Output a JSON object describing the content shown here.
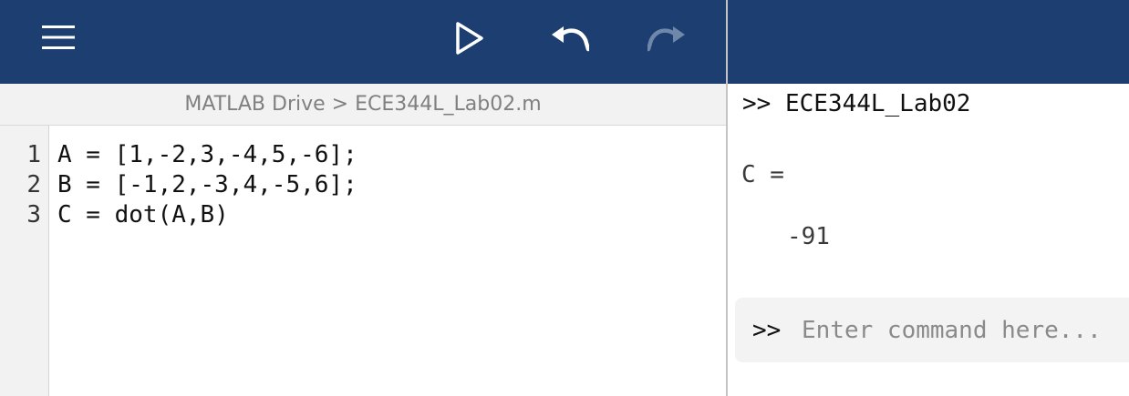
{
  "toolbar": {
    "background": "#1c3e70",
    "icons": {
      "menu": "hamburger-menu-icon",
      "run": "run-icon",
      "undo": "undo-icon",
      "redo": "redo-icon"
    },
    "redo_enabled": false
  },
  "breadcrumb": {
    "text": "MATLAB Drive > ECE344L_Lab02.m"
  },
  "editor": {
    "lines": [
      {
        "number": "1",
        "code": "A = [1,-2,3,-4,5,-6];"
      },
      {
        "number": "2",
        "code": "B = [-1,2,-3,4,-5,6];"
      },
      {
        "number": "3",
        "code": "C = dot(A,B)"
      }
    ]
  },
  "console": {
    "command_echo": ">> ECE344L_Lab02",
    "output_variable": "C =",
    "output_value": "-91",
    "prompt": ">>",
    "input_value": "",
    "input_placeholder": "Enter command here..."
  }
}
